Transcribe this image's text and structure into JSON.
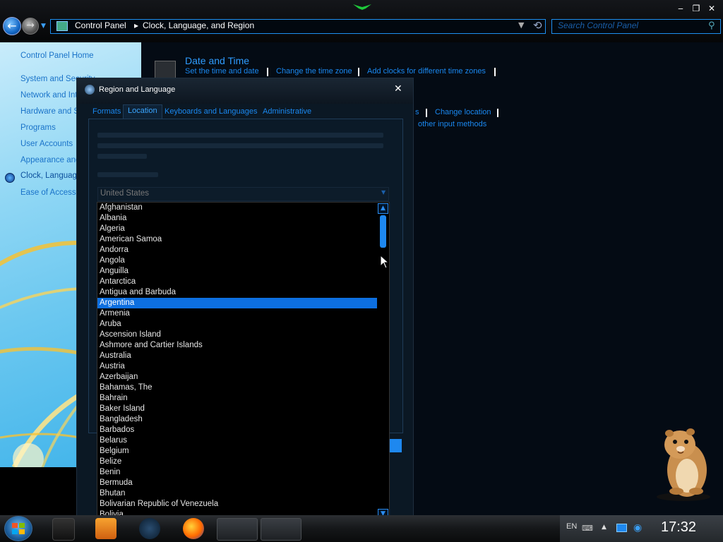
{
  "window": {
    "address_crumbs": [
      "Control Panel",
      "Clock, Language, and Region"
    ],
    "search_placeholder": "Search Control Panel"
  },
  "left_nav": {
    "home": "Control Panel Home",
    "items": [
      {
        "label": "System and Security"
      },
      {
        "label": "Network and Internet"
      },
      {
        "label": "Hardware and Sound"
      },
      {
        "label": "Programs"
      },
      {
        "label": "User Accounts"
      },
      {
        "label": "Appearance and Personalization"
      },
      {
        "label": "Clock, Language, and Region",
        "active": true
      },
      {
        "label": "Ease of Access"
      }
    ]
  },
  "main": {
    "category_title": "Date and Time",
    "links": [
      "Set the time and date",
      "Change the time zone",
      "Add clocks for different time zones"
    ],
    "second_row_links": [
      "s",
      "Change location"
    ],
    "third_row_link": "other input methods"
  },
  "dialog": {
    "title": "Region and Language",
    "tabs": [
      {
        "label": "Formats",
        "selected": false
      },
      {
        "label": "Location",
        "selected": true
      },
      {
        "label": "Keyboards and Languages",
        "selected": false
      },
      {
        "label": "Administrative",
        "selected": false
      }
    ],
    "combo_value": "United States",
    "countries": [
      "Afghanistan",
      "Albania",
      "Algeria",
      "American Samoa",
      "Andorra",
      "Angola",
      "Anguilla",
      "Antarctica",
      "Antigua and Barbuda",
      "Argentina",
      "Armenia",
      "Aruba",
      "Ascension Island",
      "Ashmore and Cartier Islands",
      "Australia",
      "Austria",
      "Azerbaijan",
      "Bahamas, The",
      "Bahrain",
      "Baker Island",
      "Bangladesh",
      "Barbados",
      "Belarus",
      "Belgium",
      "Belize",
      "Benin",
      "Bermuda",
      "Bhutan",
      "Bolivarian Republic of Venezuela",
      "Bolivia"
    ],
    "selected_country": "Argentina"
  },
  "taskbar": {
    "language": "EN",
    "clock": "17:32"
  },
  "colors": {
    "accent": "#1e88ef",
    "link": "#1a88f0",
    "selection": "#0d6fe0"
  }
}
